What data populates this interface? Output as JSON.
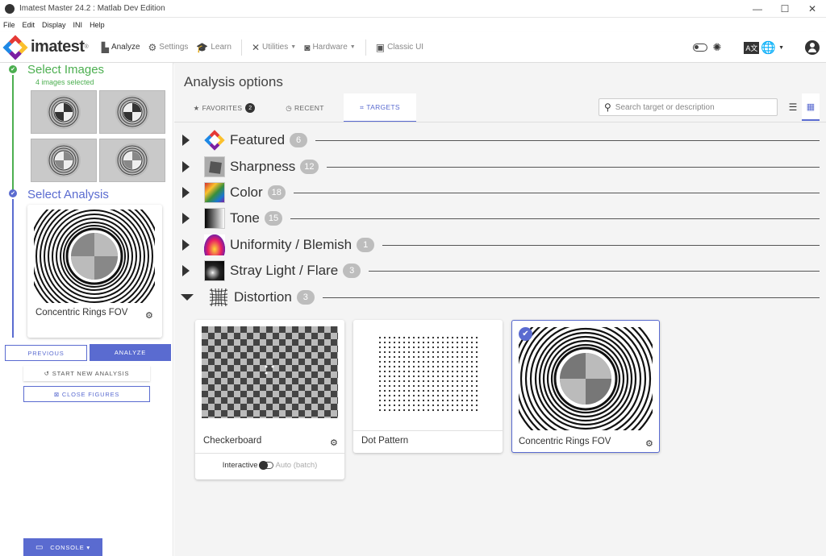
{
  "window": {
    "title": "Imatest Master 24.2 : Matlab Dev Edition",
    "buttons": [
      "—",
      "☐",
      "✕"
    ]
  },
  "menu": [
    "File",
    "Edit",
    "Display",
    "INI",
    "Help"
  ],
  "toolbar": {
    "logo": "imatest",
    "logo_reg": "®",
    "items": [
      {
        "label": "Analyze",
        "icon": "chart-icon"
      },
      {
        "label": "Settings",
        "icon": "gear-icon"
      },
      {
        "label": "Learn",
        "icon": "mortarboard-icon"
      },
      {
        "label": "Utilities",
        "icon": "tools-icon"
      },
      {
        "label": "Hardware",
        "icon": "camera-icon"
      },
      {
        "label": "Classic UI",
        "icon": "window-icon"
      }
    ]
  },
  "sidebar": {
    "step1": {
      "title": "Select Images",
      "sub": "4 images selected"
    },
    "step2": {
      "title": "Select Analysis"
    },
    "selected_analysis": "Concentric Rings FOV",
    "previous": "PREVIOUS",
    "analyze": "ANALYZE",
    "start_new": "START NEW ANALYSIS",
    "close_figures": "CLOSE FIGURES",
    "console": "CONSOLE ▾"
  },
  "main": {
    "title": "Analysis options",
    "tabs": [
      {
        "label": "FAVORITES",
        "badge": "2"
      },
      {
        "label": "RECENT"
      },
      {
        "label": "TARGETS"
      }
    ],
    "search_placeholder": "Search target or description",
    "categories": [
      {
        "name": "Featured",
        "count": "6"
      },
      {
        "name": "Sharpness",
        "count": "12"
      },
      {
        "name": "Color",
        "count": "18"
      },
      {
        "name": "Tone",
        "count": "15"
      },
      {
        "name": "Uniformity / Blemish",
        "count": "1"
      },
      {
        "name": "Stray Light / Flare",
        "count": "3"
      },
      {
        "name": "Distortion",
        "count": "3"
      }
    ],
    "targets": [
      {
        "name": "Checkerboard",
        "interactive": "Interactive",
        "auto": "Auto (batch)"
      },
      {
        "name": "Dot Pattern"
      },
      {
        "name": "Concentric Rings FOV"
      }
    ]
  },
  "colors": {
    "accent": "#5a6bd0",
    "green": "#4caf50"
  }
}
